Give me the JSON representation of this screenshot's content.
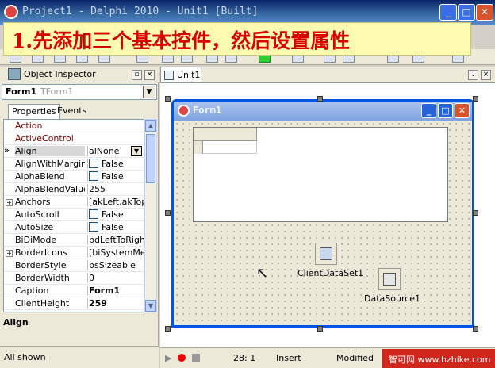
{
  "window": {
    "title": "Project1 - Delphi 2010 - Unit1 [Built]",
    "min": "_",
    "max": "□",
    "close": "✕"
  },
  "banner": {
    "text": "1.先添加三个基本控件，然后设置属性"
  },
  "inspector": {
    "title": "Object Inspector",
    "pin": "▫",
    "close": "×",
    "selected_name": "Form1",
    "selected_type": "TForm1",
    "tabs": [
      "Properties",
      "Events"
    ],
    "properties": [
      {
        "name": "Action",
        "value": "",
        "style": "red"
      },
      {
        "name": "ActiveControl",
        "value": "",
        "style": "red"
      },
      {
        "name": "Align",
        "value": "alNone",
        "selected": true
      },
      {
        "name": "AlignWithMargins",
        "value": "False",
        "check": true
      },
      {
        "name": "AlphaBlend",
        "value": "False",
        "check": true
      },
      {
        "name": "AlphaBlendValue",
        "value": "255"
      },
      {
        "name": "Anchors",
        "value": "[akLeft,akTop]",
        "expand": true
      },
      {
        "name": "AutoScroll",
        "value": "False",
        "check": true
      },
      {
        "name": "AutoSize",
        "value": "False",
        "check": true
      },
      {
        "name": "BiDiMode",
        "value": "bdLeftToRight"
      },
      {
        "name": "BorderIcons",
        "value": "[biSystemMenu",
        "expand": true
      },
      {
        "name": "BorderStyle",
        "value": "bsSizeable"
      },
      {
        "name": "BorderWidth",
        "value": "0"
      },
      {
        "name": "Caption",
        "value": "Form1",
        "bold": true
      },
      {
        "name": "ClientHeight",
        "value": "259",
        "bold": true
      }
    ],
    "description": "Align",
    "status": "All shown"
  },
  "designer": {
    "tab": "Unit1",
    "form_title": "Form1",
    "components": [
      {
        "label": "ClientDataSet1",
        "icon": "client-dataset-icon"
      },
      {
        "label": "DataSource1",
        "icon": "datasource-icon"
      }
    ]
  },
  "statusbar": {
    "position": "28:  1",
    "mode": "Insert",
    "state": "Modified"
  },
  "watermark": {
    "text": "智可网 www.hzhike.com"
  },
  "colors": {
    "banner_text": "#d80000",
    "banner_bg": "#fdfbb0",
    "titlebar": "#0a246a"
  }
}
